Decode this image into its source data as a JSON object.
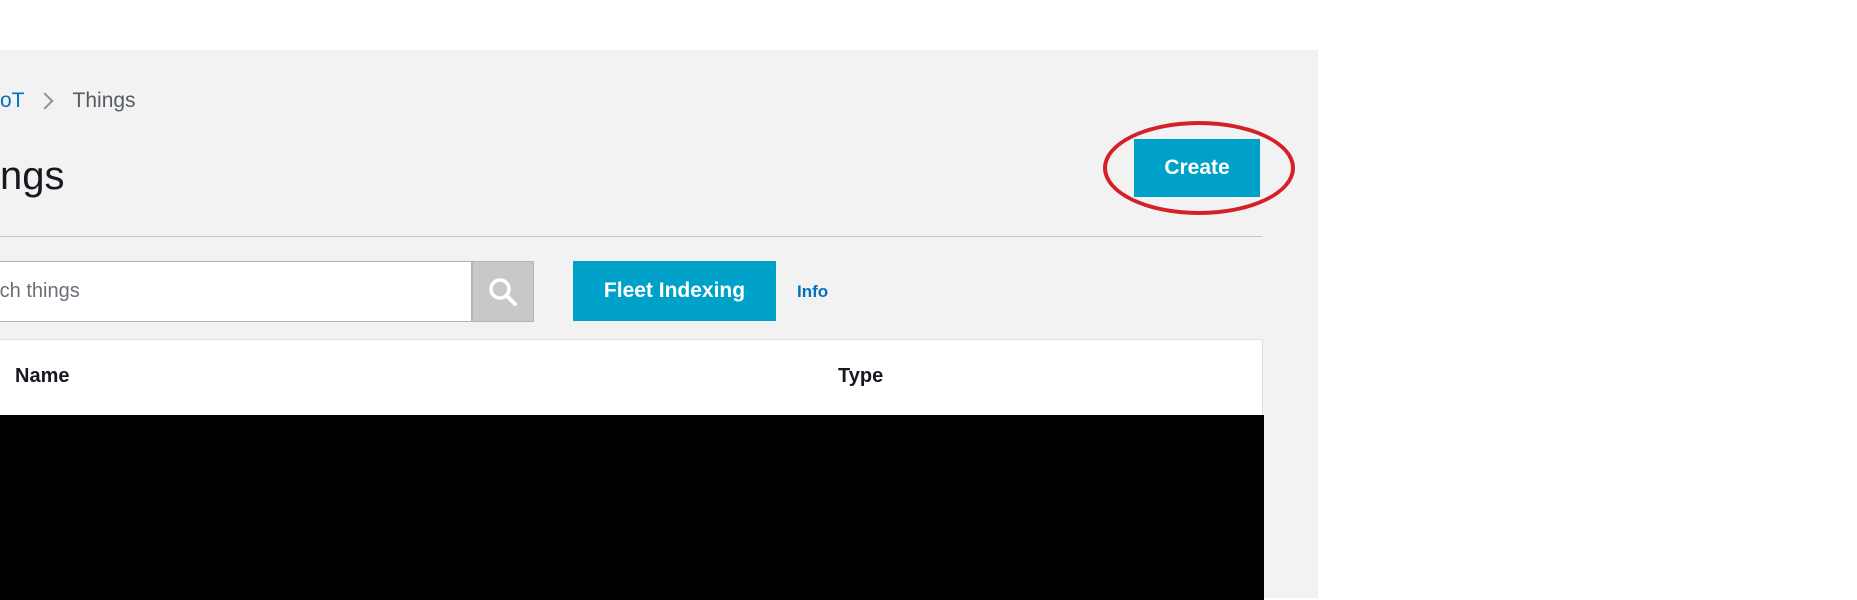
{
  "breadcrumb": {
    "parent": "oT",
    "current": "Things"
  },
  "page": {
    "title": "ngs"
  },
  "toolbar": {
    "create_label": "Create"
  },
  "search": {
    "placeholder": "rch things"
  },
  "actions": {
    "fleet_indexing_label": "Fleet Indexing",
    "info_label": "Info"
  },
  "table": {
    "columns": [
      "Name",
      "Type"
    ]
  },
  "icons": {
    "breadcrumb_separator": "chevron-right-icon",
    "search": "search-icon"
  },
  "colors": {
    "primary_button": "#00a1c9",
    "link": "#0073bb",
    "highlight_ring": "#d62027",
    "panel_bg": "#f2f2f2"
  }
}
